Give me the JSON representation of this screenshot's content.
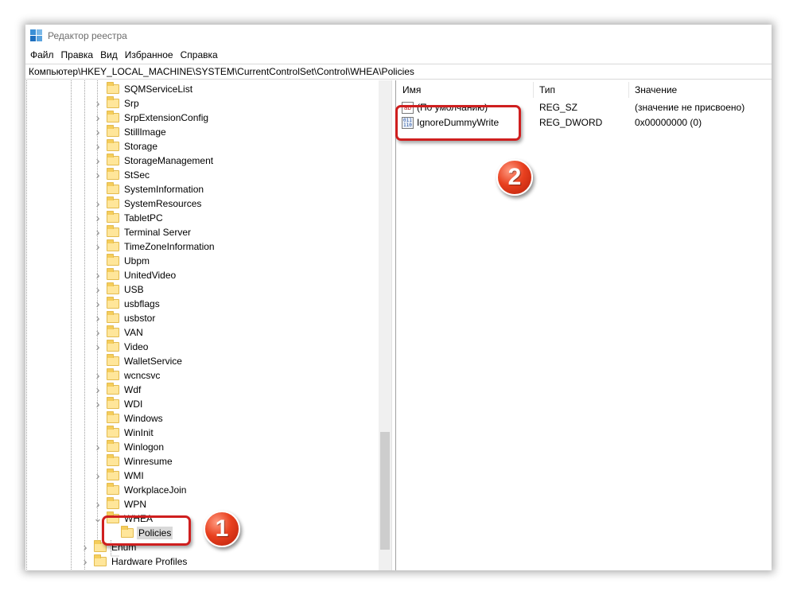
{
  "window": {
    "title": "Редактор реестра",
    "address": "Компьютер\\HKEY_LOCAL_MACHINE\\SYSTEM\\CurrentControlSet\\Control\\WHEA\\Policies"
  },
  "menu": [
    "Файл",
    "Правка",
    "Вид",
    "Избранное",
    "Справка"
  ],
  "tree": [
    {
      "label": "SQMServiceList",
      "expand": false
    },
    {
      "label": "Srp",
      "expand": true
    },
    {
      "label": "SrpExtensionConfig",
      "expand": true
    },
    {
      "label": "StillImage",
      "expand": true
    },
    {
      "label": "Storage",
      "expand": true
    },
    {
      "label": "StorageManagement",
      "expand": true
    },
    {
      "label": "StSec",
      "expand": true
    },
    {
      "label": "SystemInformation",
      "expand": false
    },
    {
      "label": "SystemResources",
      "expand": true
    },
    {
      "label": "TabletPC",
      "expand": true
    },
    {
      "label": "Terminal Server",
      "expand": true
    },
    {
      "label": "TimeZoneInformation",
      "expand": true
    },
    {
      "label": "Ubpm",
      "expand": false
    },
    {
      "label": "UnitedVideo",
      "expand": true
    },
    {
      "label": "USB",
      "expand": true
    },
    {
      "label": "usbflags",
      "expand": true
    },
    {
      "label": "usbstor",
      "expand": true
    },
    {
      "label": "VAN",
      "expand": true
    },
    {
      "label": "Video",
      "expand": true
    },
    {
      "label": "WalletService",
      "expand": false
    },
    {
      "label": "wcncsvc",
      "expand": true
    },
    {
      "label": "Wdf",
      "expand": true
    },
    {
      "label": "WDI",
      "expand": true
    },
    {
      "label": "Windows",
      "expand": false
    },
    {
      "label": "WinInit",
      "expand": false
    },
    {
      "label": "Winlogon",
      "expand": true
    },
    {
      "label": "Winresume",
      "expand": false
    },
    {
      "label": "WMI",
      "expand": true
    },
    {
      "label": "WorkplaceJoin",
      "expand": false
    },
    {
      "label": "WPN",
      "expand": true
    },
    {
      "label": "WHEA",
      "expand": "open"
    },
    {
      "label": "Policies",
      "expand": "child",
      "selected": true
    },
    {
      "label": "Enum",
      "expand": true,
      "level": 0
    },
    {
      "label": "Hardware Profiles",
      "expand": true,
      "level": 0
    }
  ],
  "list": {
    "headers": [
      "Имя",
      "Тип",
      "Значение"
    ],
    "rows": [
      {
        "name": "(По умолчанию)",
        "type": "REG_SZ",
        "value": "(значение не присвоено)",
        "icon": "string-value-icon"
      },
      {
        "name": "IgnoreDummyWrite",
        "type": "REG_DWORD",
        "value": "0x00000000 (0)",
        "icon": "dword-value-icon"
      }
    ]
  },
  "annotations": [
    "1",
    "2"
  ],
  "colors": {
    "highlight": "#cf1f1f",
    "badge": "#e8401f"
  }
}
